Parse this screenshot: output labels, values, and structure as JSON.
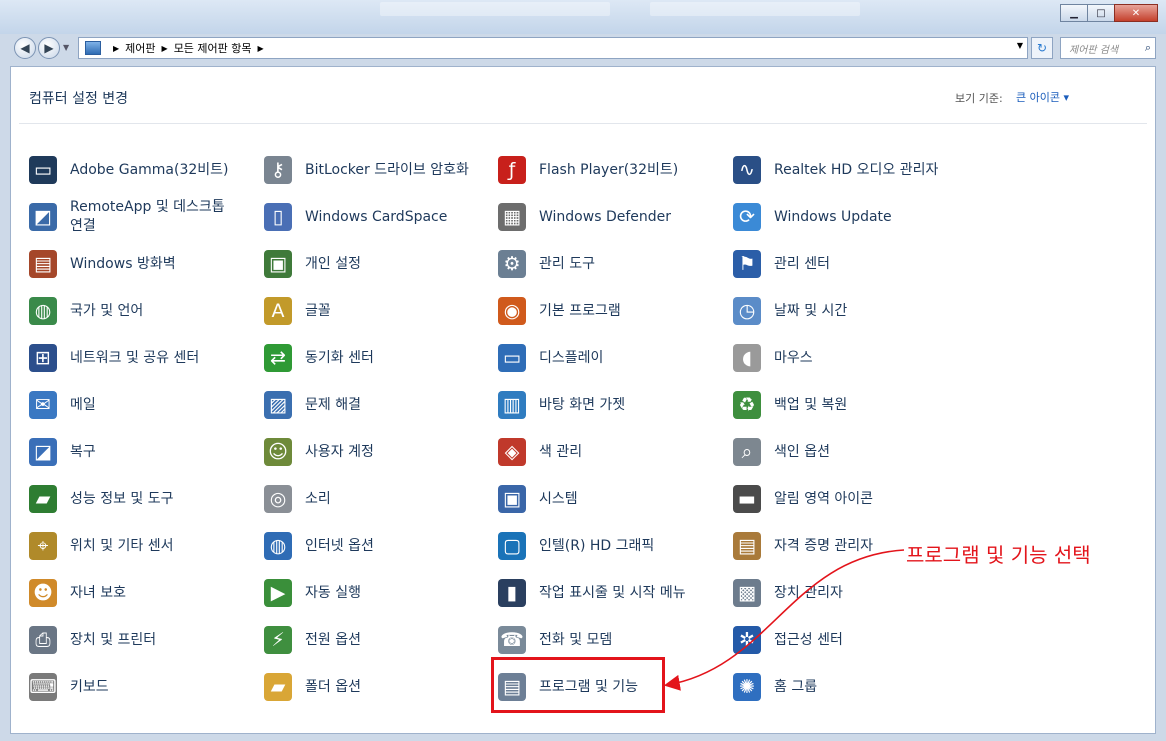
{
  "window": {
    "minimize_label": "▁",
    "maximize_label": "□",
    "close_label": "✕"
  },
  "address": {
    "crumbs": [
      "제어판",
      "모든 제어판 항목"
    ],
    "search_placeholder": "제어판 검색"
  },
  "header": {
    "title": "컴퓨터 설정 변경",
    "view_by_label": "보기 기준:",
    "view_by_value": "큰 아이콘 ▾"
  },
  "items": [
    {
      "label": "Adobe Gamma(32비트)",
      "icon": "monitor-icon",
      "glyph": "▭",
      "color": "#1f3a5a"
    },
    {
      "label": "BitLocker 드라이브 암호화",
      "icon": "bitlocker-key-icon",
      "glyph": "⚷",
      "color": "#7a8591"
    },
    {
      "label": "Flash Player(32비트)",
      "icon": "flash-icon",
      "glyph": "ƒ",
      "color": "#c8201b"
    },
    {
      "label": "Realtek HD 오디오 관리자",
      "icon": "audio-manager-icon",
      "glyph": "∿",
      "color": "#2a4f86"
    },
    {
      "label": "RemoteApp 및 데스크톱 연결",
      "icon": "remote-desktop-icon",
      "glyph": "◩",
      "color": "#3a6aa8"
    },
    {
      "label": "Windows CardSpace",
      "icon": "cardspace-icon",
      "glyph": "▯",
      "color": "#4a6fb5"
    },
    {
      "label": "Windows Defender",
      "icon": "defender-icon",
      "glyph": "▦",
      "color": "#6d6d6d"
    },
    {
      "label": "Windows Update",
      "icon": "windows-update-icon",
      "glyph": "⟳",
      "color": "#3b8ad6"
    },
    {
      "label": "Windows 방화벽",
      "icon": "firewall-icon",
      "glyph": "▤",
      "color": "#a5472a"
    },
    {
      "label": "개인 설정",
      "icon": "personalization-icon",
      "glyph": "▣",
      "color": "#3f7a3a"
    },
    {
      "label": "관리 도구",
      "icon": "admin-tools-icon",
      "glyph": "⚙",
      "color": "#6b7f93"
    },
    {
      "label": "관리 센터",
      "icon": "action-center-flag-icon",
      "glyph": "⚑",
      "color": "#2b5ea8"
    },
    {
      "label": "국가 및 언어",
      "icon": "region-language-icon",
      "glyph": "◍",
      "color": "#3a8a4a"
    },
    {
      "label": "글꼴",
      "icon": "fonts-icon",
      "glyph": "A",
      "color": "#c29a2a"
    },
    {
      "label": "기본 프로그램",
      "icon": "default-programs-icon",
      "glyph": "◉",
      "color": "#d05a1c"
    },
    {
      "label": "날짜 및 시간",
      "icon": "date-time-icon",
      "glyph": "◷",
      "color": "#5b8cc8"
    },
    {
      "label": "네트워크 및 공유 센터",
      "icon": "network-sharing-icon",
      "glyph": "⊞",
      "color": "#2c4f8c"
    },
    {
      "label": "동기화 센터",
      "icon": "sync-center-icon",
      "glyph": "⇄",
      "color": "#2f9a35"
    },
    {
      "label": "디스플레이",
      "icon": "display-icon",
      "glyph": "▭",
      "color": "#2f6db7"
    },
    {
      "label": "마우스",
      "icon": "mouse-icon",
      "glyph": "◖",
      "color": "#9a9a9a"
    },
    {
      "label": "메일",
      "icon": "mail-icon",
      "glyph": "✉",
      "color": "#3a78c2"
    },
    {
      "label": "문제 해결",
      "icon": "troubleshooting-icon",
      "glyph": "▨",
      "color": "#3b6fb0"
    },
    {
      "label": "바탕 화면 가젯",
      "icon": "desktop-gadgets-icon",
      "glyph": "▥",
      "color": "#2f7cc0"
    },
    {
      "label": "백업 및 복원",
      "icon": "backup-restore-icon",
      "glyph": "♻",
      "color": "#3e8f3e"
    },
    {
      "label": "복구",
      "icon": "recovery-icon",
      "glyph": "◪",
      "color": "#3a6fb8"
    },
    {
      "label": "사용자 계정",
      "icon": "user-accounts-icon",
      "glyph": "☺",
      "color": "#6e8a3a"
    },
    {
      "label": "색 관리",
      "icon": "color-management-icon",
      "glyph": "◈",
      "color": "#c0392b"
    },
    {
      "label": "색인 옵션",
      "icon": "indexing-options-icon",
      "glyph": "⌕",
      "color": "#7d8790"
    },
    {
      "label": "성능 정보 및 도구",
      "icon": "performance-icon",
      "glyph": "▰",
      "color": "#2e7d32"
    },
    {
      "label": "소리",
      "icon": "sound-icon",
      "glyph": "◎",
      "color": "#8a8f96"
    },
    {
      "label": "시스템",
      "icon": "system-icon",
      "glyph": "▣",
      "color": "#3a66a8"
    },
    {
      "label": "알림 영역 아이콘",
      "icon": "notification-area-icon",
      "glyph": "▬",
      "color": "#4b4b4b"
    },
    {
      "label": "위치 및 기타 센서",
      "icon": "location-sensors-icon",
      "glyph": "⌖",
      "color": "#b08a2a"
    },
    {
      "label": "인터넷 옵션",
      "icon": "internet-options-icon",
      "glyph": "◍",
      "color": "#2f6cb5"
    },
    {
      "label": "인텔(R) HD 그래픽",
      "icon": "intel-graphics-icon",
      "glyph": "▢",
      "color": "#1a73b8"
    },
    {
      "label": "자격 증명 관리자",
      "icon": "credential-manager-icon",
      "glyph": "▤",
      "color": "#a97a3a"
    },
    {
      "label": "자녀 보호",
      "icon": "parental-controls-icon",
      "glyph": "☻",
      "color": "#d08a2a"
    },
    {
      "label": "자동 실행",
      "icon": "autoplay-icon",
      "glyph": "▶",
      "color": "#3a8f3a"
    },
    {
      "label": "작업 표시줄 및 시작 메뉴",
      "icon": "taskbar-start-menu-icon",
      "glyph": "▮",
      "color": "#2a3f5f"
    },
    {
      "label": "장치 관리자",
      "icon": "device-manager-icon",
      "glyph": "▩",
      "color": "#6d7c8d"
    },
    {
      "label": "장치 및 프린터",
      "icon": "devices-printers-icon",
      "glyph": "⎙",
      "color": "#6a7685"
    },
    {
      "label": "전원 옵션",
      "icon": "power-options-icon",
      "glyph": "⚡",
      "color": "#3f8f3f"
    },
    {
      "label": "전화 및 모뎀",
      "icon": "phone-modem-icon",
      "glyph": "☎",
      "color": "#7a8a99"
    },
    {
      "label": "접근성 센터",
      "icon": "ease-of-access-icon",
      "glyph": "✲",
      "color": "#245aa8"
    },
    {
      "label": "키보드",
      "icon": "keyboard-icon",
      "glyph": "⌨",
      "color": "#7a7a7a"
    },
    {
      "label": "폴더 옵션",
      "icon": "folder-options-icon",
      "glyph": "▰",
      "color": "#d9a636"
    },
    {
      "label": "프로그램 및 기능",
      "icon": "programs-features-icon",
      "glyph": "▤",
      "color": "#6d7f96"
    },
    {
      "label": "홈 그룹",
      "icon": "homegroup-icon",
      "glyph": "✺",
      "color": "#2f6fc0"
    }
  ],
  "annotation": {
    "text": "프로그램 및 기능 선택",
    "color": "#e3141b"
  }
}
